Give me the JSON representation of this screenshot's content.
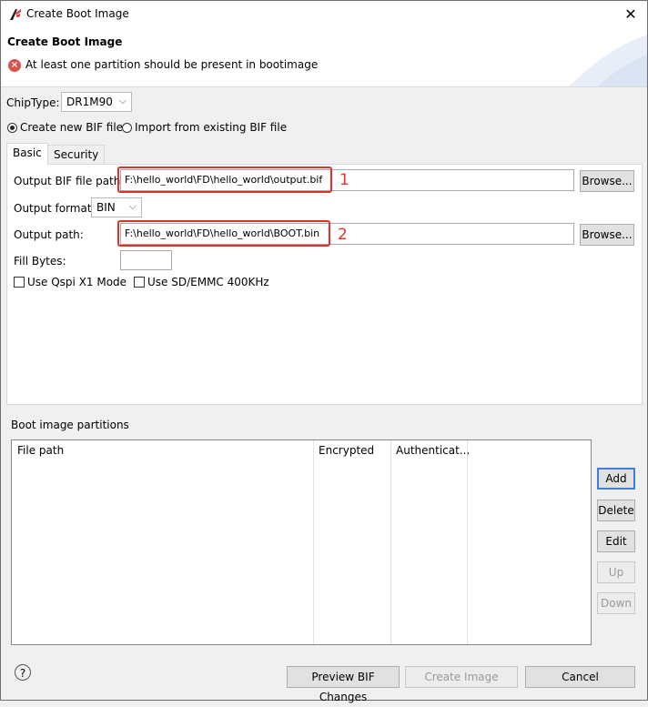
{
  "window": {
    "title": "Create Boot Image",
    "close_glyph": "✕"
  },
  "header": {
    "title": "Create Boot Image",
    "error_message": "At least one partition should be present in bootimage",
    "error_icon": "error-x-icon"
  },
  "chip": {
    "label": "ChipType:",
    "value": "DR1M90"
  },
  "bif_mode": {
    "option_new": "Create new BIF file",
    "option_import": "Import from existing BIF file",
    "selected": "new"
  },
  "tabs": [
    {
      "label": "Basic",
      "active": true
    },
    {
      "label": "Security",
      "active": false
    }
  ],
  "basic": {
    "output_bif_label": "Output BIF file path:",
    "output_bif_value": "F:\\hello_world\\FD\\hello_world\\output.bif",
    "output_format_label": "Output format:",
    "output_format_value": "BIN",
    "output_path_label": "Output path:",
    "output_path_value": "F:\\hello_world\\FD\\hello_world\\BOOT.bin",
    "fill_bytes_label": "Fill Bytes:",
    "fill_bytes_value": "",
    "browse_label": "Browse...",
    "qspi_label": "Use Qspi X1 Mode",
    "sd_label": "Use SD/EMMC 400KHz",
    "qspi_checked": false,
    "sd_checked": false
  },
  "annotations": {
    "marker_1": "1",
    "marker_2": "2",
    "highlight_color": "#e0312a"
  },
  "partitions": {
    "title": "Boot image partitions",
    "columns": [
      "File path",
      "Encrypted",
      "Authenticat..."
    ],
    "rows": []
  },
  "side_buttons": {
    "add": "Add",
    "delete": "Delete",
    "edit": "Edit",
    "up": "Up",
    "down": "Down"
  },
  "footer": {
    "help_glyph": "?",
    "preview": "Preview BIF Changes",
    "create": "Create Image",
    "cancel": "Cancel"
  }
}
